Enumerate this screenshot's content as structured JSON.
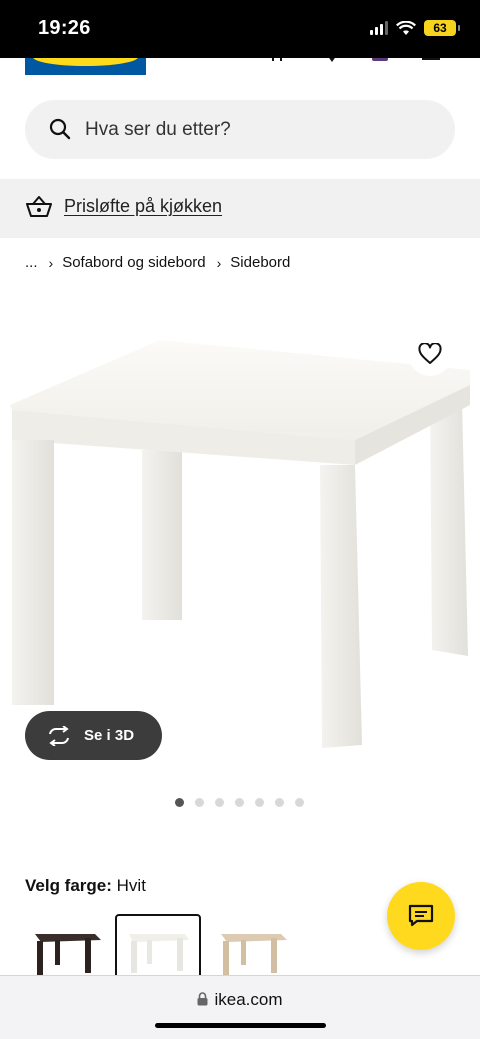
{
  "status_bar": {
    "time": "19:26",
    "battery": "63"
  },
  "header": {
    "logo": "IKEA"
  },
  "search": {
    "placeholder": "Hva ser du etter?"
  },
  "promo": {
    "label": "Prisløfte på kjøkken"
  },
  "breadcrumb": [
    {
      "label": "..."
    },
    {
      "label": "Sofabord og sidebord"
    },
    {
      "label": "Sidebord"
    }
  ],
  "gallery": {
    "view3d_label": "Se i 3D",
    "image_count": 7,
    "active_index": 0
  },
  "color_picker": {
    "label": "Velg farge:",
    "value": "Hvit",
    "swatches": [
      {
        "name": "black-brown",
        "color": "#3a2e2a"
      },
      {
        "name": "white",
        "color": "#f4f2ec",
        "selected": true
      },
      {
        "name": "white-stained-oak",
        "color": "#d9c7ad"
      }
    ]
  },
  "browser": {
    "url": "ikea.com"
  },
  "colors": {
    "accent": "#ffd91d",
    "brand_blue": "#0058a3",
    "brand_yellow": "#ffda1a"
  }
}
